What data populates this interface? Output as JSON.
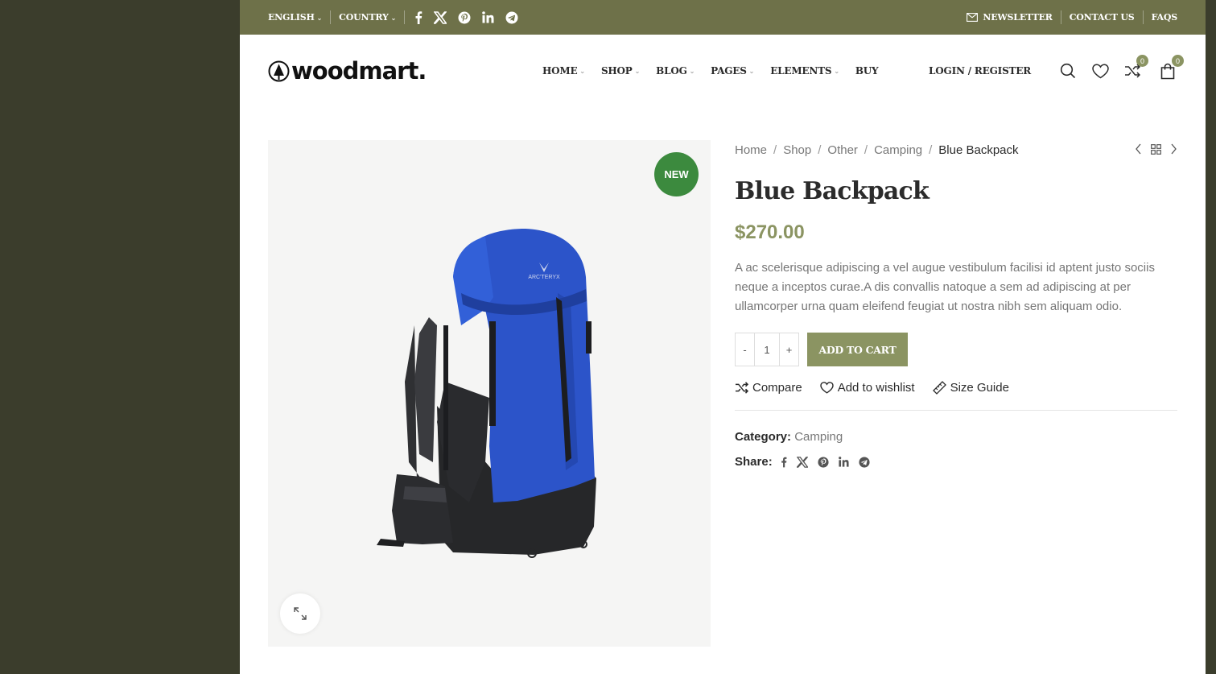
{
  "topbar": {
    "language": "ENGLISH",
    "country": "COUNTRY",
    "social": [
      "facebook-icon",
      "x-icon",
      "pinterest-icon",
      "linkedin-icon",
      "telegram-icon"
    ],
    "newsletter": "NEWSLETTER",
    "contact": "CONTACT US",
    "faqs": "FAQS"
  },
  "header": {
    "logo": "woodmart.",
    "nav": [
      "HOME",
      "SHOP",
      "BLOG",
      "PAGES",
      "ELEMENTS",
      "BUY"
    ],
    "login": "LOGIN / REGISTER",
    "compare_count": "0",
    "cart_count": "0"
  },
  "product": {
    "badge": "NEW",
    "breadcrumbs": [
      "Home",
      "Shop",
      "Other",
      "Camping"
    ],
    "breadcrumb_current": "Blue Backpack",
    "title": "Blue Backpack",
    "price": "$270.00",
    "description": "A ac scelerisque adipiscing a vel augue vestibulum facilisi id aptent justo sociis neque a inceptos curae.A dis convallis natoque a sem ad adipiscing at per ullamcorper urna quam eleifend feugiat ut nostra nibh sem aliquam odio.",
    "qty_minus": "-",
    "qty": "1",
    "qty_plus": "+",
    "add_to_cart": "ADD TO CART",
    "compare": "Compare",
    "wishlist": "Add to wishlist",
    "size_guide": "Size Guide",
    "category_label": "Category:",
    "category": "Camping",
    "share_label": "Share:"
  },
  "colors": {
    "topbar": "#6e7149",
    "accent": "#8b9462",
    "new_badge": "#3c8a3e",
    "backdrop": "#3b3d2c"
  }
}
